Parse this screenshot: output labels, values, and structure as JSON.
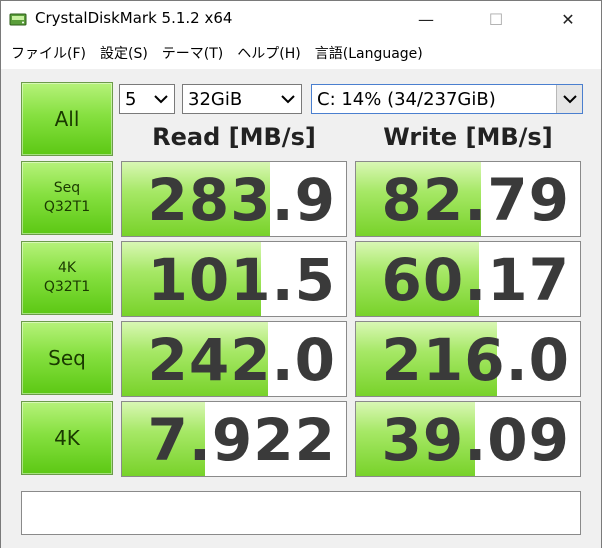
{
  "window": {
    "title": "CrystalDiskMark 5.1.2 x64",
    "minimize": "—",
    "maximize": "☐",
    "close": "✕"
  },
  "menu": {
    "items": [
      "ファイル(F)",
      "設定(S)",
      "テーマ(T)",
      "ヘルプ(H)",
      "言語(Language)"
    ]
  },
  "controls": {
    "all_label": "All",
    "count": "5",
    "size": "32GiB",
    "drive": "C: 14% (34/237GiB)"
  },
  "headers": {
    "read": "Read [MB/s]",
    "write": "Write [MB/s]"
  },
  "tests": [
    {
      "line1": "Seq",
      "line2": "Q32T1",
      "read": "283.9",
      "write": "82.79",
      "read_fill": 0.66,
      "write_fill": 0.56
    },
    {
      "line1": "4K",
      "line2": "Q32T1",
      "read": "101.5",
      "write": "60.17",
      "read_fill": 0.62,
      "write_fill": 0.55
    },
    {
      "line1": "Seq",
      "line2": "",
      "read": "242.0",
      "write": "216.0",
      "read_fill": 0.65,
      "write_fill": 0.63
    },
    {
      "line1": "4K",
      "line2": "",
      "read": "7.922",
      "write": "39.09",
      "read_fill": 0.37,
      "write_fill": 0.53
    }
  ],
  "comment": "",
  "colors": {
    "accent_green": "#78d22a",
    "value_text": "#3a3a3a"
  }
}
